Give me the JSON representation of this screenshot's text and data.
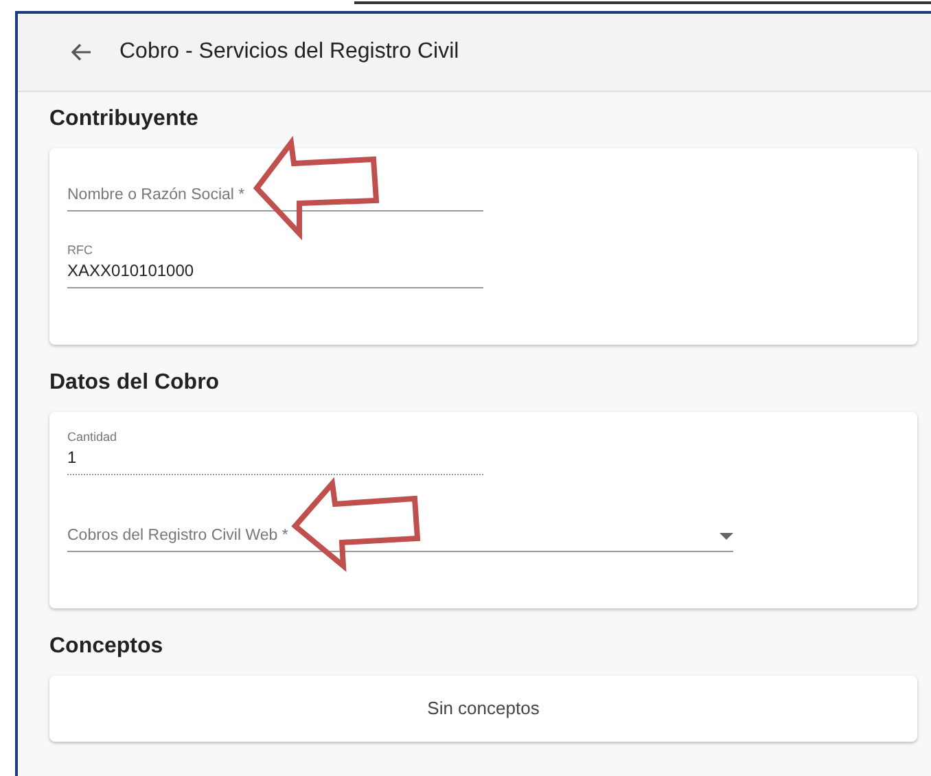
{
  "header": {
    "title": "Cobro - Servicios del Registro Civil"
  },
  "sections": [
    {
      "heading": "Contribuyente",
      "fields": [
        {
          "kind": "text",
          "placeholder": "Nombre o Razón Social *",
          "disabled": false
        },
        {
          "kind": "text",
          "label": "RFC",
          "value": "XAXX010101000",
          "disabled": false
        }
      ]
    },
    {
      "heading": "Datos del Cobro",
      "fields": [
        {
          "kind": "text",
          "label": "Cantidad",
          "value": "1",
          "disabled": true
        },
        {
          "kind": "select",
          "placeholder": "Cobros del Registro Civil Web *",
          "disabled": false
        }
      ]
    },
    {
      "heading": "Conceptos",
      "empty_message": "Sin conceptos"
    }
  ]
}
